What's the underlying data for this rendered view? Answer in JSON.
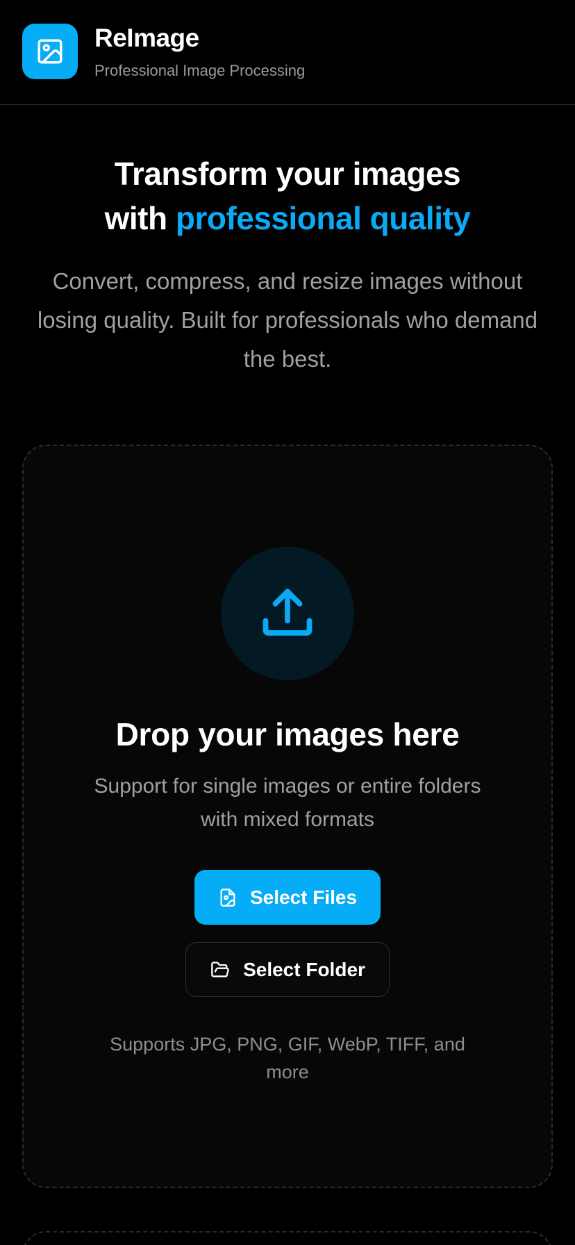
{
  "header": {
    "brand_name": "ReImage",
    "brand_subtitle": "Professional Image Processing",
    "logo_icon": "image-icon"
  },
  "hero": {
    "title_line1": "Transform your images",
    "title_line2_prefix": "with ",
    "title_line2_accent": "professional quality",
    "description": "Convert, compress, and resize images without losing quality. Built for professionals who demand the best."
  },
  "dropzone": {
    "icon": "upload-icon",
    "title": "Drop your images here",
    "description": "Support for single images or entire folders with mixed formats",
    "select_files_label": "Select Files",
    "select_folder_label": "Select Folder",
    "formats_note": "Supports JPG, PNG, GIF, WebP, TIFF, and more"
  },
  "colors": {
    "accent": "#06adf6",
    "background": "#000000",
    "muted_text": "#a0a0a0"
  }
}
